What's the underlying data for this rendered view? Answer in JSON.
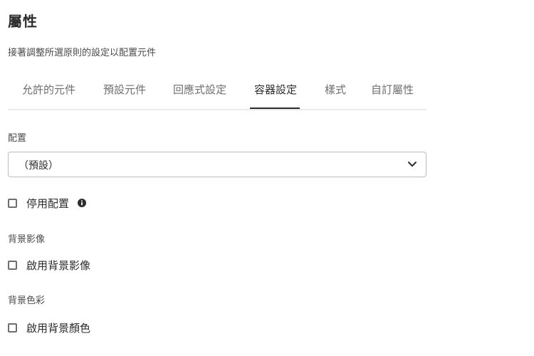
{
  "header": {
    "title": "屬性",
    "subtitle": "接著調整所選原則的設定以配置元件"
  },
  "tabs": [
    {
      "label": "允許的元件",
      "active": false
    },
    {
      "label": "預設元件",
      "active": false
    },
    {
      "label": "回應式設定",
      "active": false
    },
    {
      "label": "容器設定",
      "active": true
    },
    {
      "label": "樣式",
      "active": false
    },
    {
      "label": "自訂屬性",
      "active": false
    }
  ],
  "layout_field": {
    "label": "配置",
    "selected_value": "（預設）",
    "disable_label": "停用配置",
    "disable_checked": false
  },
  "background_image": {
    "label": "背景影像",
    "enable_label": "啟用背景影像",
    "enable_checked": false
  },
  "background_color": {
    "label": "背景色彩",
    "enable_label": "啟用背景顏色",
    "enable_checked": false
  },
  "colors": {
    "text": "#2c2c2c",
    "muted": "#6e6e6e",
    "border": "#bcbcbc",
    "active_tab_indicator": "#2c2c2c"
  }
}
